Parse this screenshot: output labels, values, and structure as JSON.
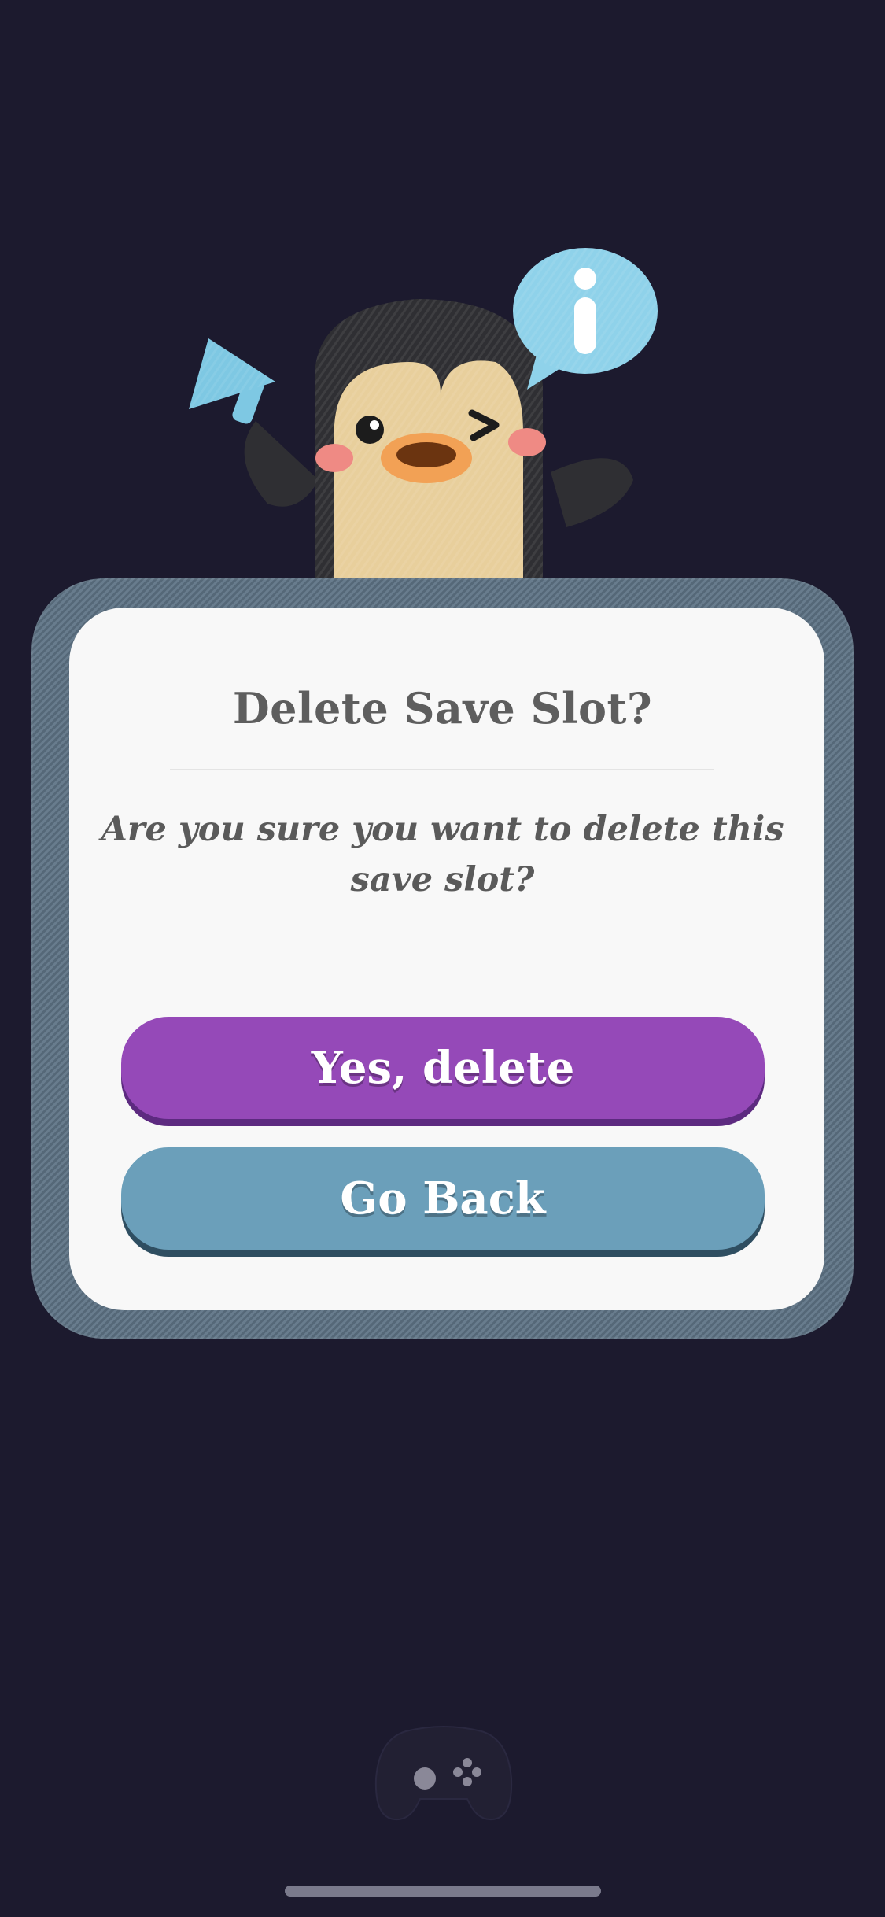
{
  "dialog": {
    "title": "Delete Save Slot?",
    "message": "Are you sure you want to delete this save slot?",
    "confirm_label": "Yes, delete",
    "cancel_label": "Go Back"
  },
  "mascot": {
    "character": "penguin",
    "props": [
      "megaphone-icon",
      "info-speech-bubble-icon"
    ]
  },
  "footer": {
    "icon": "gamepad-icon"
  },
  "colors": {
    "background": "#1c1a2e",
    "dialog_frame": "#5f7486",
    "dialog_surface": "#f8f8f8",
    "confirm_button": "#9549b8",
    "cancel_button": "#6b9fba",
    "text": "#5e5e5e"
  }
}
